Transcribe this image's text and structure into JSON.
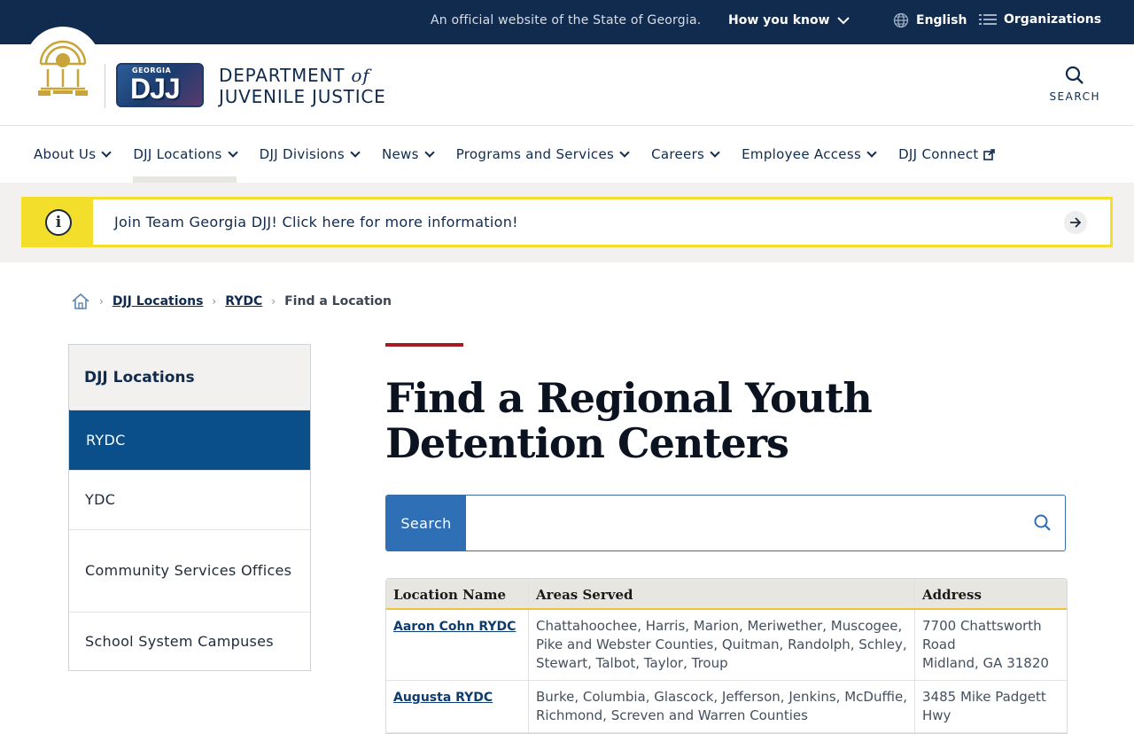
{
  "topbar": {
    "official": "An official website of the State of Georgia.",
    "how_you_know": "How you know",
    "language": "English",
    "organizations": "Organizations"
  },
  "header": {
    "logo_small": "GEORGIA",
    "logo_big": "DJJ",
    "dept_line1": "DEPARTMENT",
    "dept_of": "of",
    "dept_line2": "JUVENILE JUSTICE",
    "search_label": "SEARCH"
  },
  "nav": {
    "items": [
      {
        "label": "About Us"
      },
      {
        "label": "DJJ Locations"
      },
      {
        "label": "DJJ Divisions"
      },
      {
        "label": "News"
      },
      {
        "label": "Programs and Services"
      },
      {
        "label": "Careers"
      },
      {
        "label": "Employee Access"
      },
      {
        "label": "DJJ Connect"
      }
    ]
  },
  "alert": {
    "text": "Join Team Georgia DJJ! Click here for more information!",
    "icon_glyph": "i"
  },
  "breadcrumb": {
    "items": [
      "DJJ Locations",
      "RYDC"
    ],
    "current": "Find a Location"
  },
  "sidebar": {
    "title": "DJJ Locations",
    "links": [
      "RYDC",
      "YDC",
      "Community Services Offices",
      "School System Campuses"
    ]
  },
  "main": {
    "title": "Find a Regional Youth Detention Centers",
    "search_label": "Search",
    "search_value": "",
    "table": {
      "headers": [
        "Location Name",
        "Areas Served",
        "Address"
      ],
      "rows": [
        {
          "name": "Aaron Cohn RYDC",
          "areas": "Chattahoochee, Harris, Marion, Meriwether, Muscogee, Pike and Webster Counties, Quitman, Randolph, Schley, Stewart, Talbot, Taylor, Troup",
          "address1": "7700 Chattsworth Road",
          "address2": "Midland, GA 31820"
        },
        {
          "name": "Augusta RYDC",
          "areas": "Burke, Columbia, Glascock, Jefferson, Jenkins, McDuffie, Richmond, Screven and Warren Counties",
          "address1": "3485 Mike Padgett Hwy",
          "address2": ""
        }
      ]
    }
  },
  "colors": {
    "topbar": "#102b4e",
    "accent_blue": "#0b4f8a",
    "alert_yellow": "#f4de2c",
    "rule_red": "#a51c24"
  }
}
